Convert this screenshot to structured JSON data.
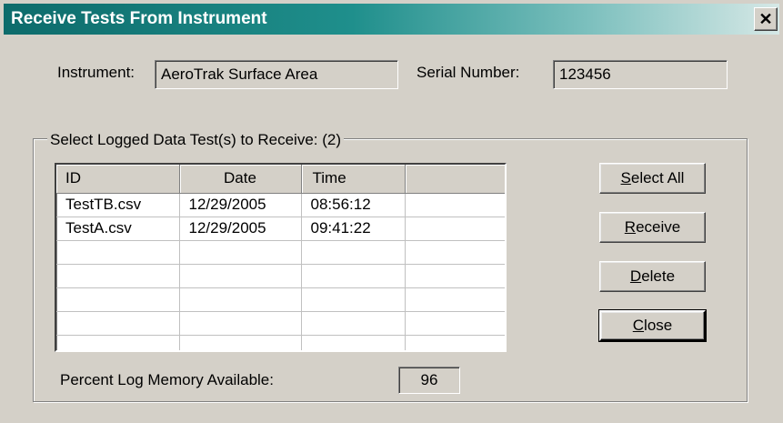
{
  "window": {
    "title": "Receive Tests From Instrument",
    "close_glyph": "✕"
  },
  "instrument": {
    "label": "Instrument:",
    "value": "AeroTrak Surface Area"
  },
  "serial": {
    "label": "Serial Number:",
    "value": "123456"
  },
  "group": {
    "title": "Select Logged Data Test(s) to Receive: (2)"
  },
  "table": {
    "columns": [
      "ID",
      "Date",
      "Time",
      ""
    ],
    "rows": [
      [
        "TestTB.csv",
        "12/29/2005",
        "08:56:12",
        ""
      ],
      [
        "TestA.csv",
        "12/29/2005",
        "09:41:22",
        ""
      ],
      [
        "",
        "",
        "",
        ""
      ],
      [
        "",
        "",
        "",
        ""
      ],
      [
        "",
        "",
        "",
        ""
      ],
      [
        "",
        "",
        "",
        ""
      ],
      [
        "",
        "",
        "",
        ""
      ]
    ]
  },
  "buttons": {
    "select_all": {
      "mnemonic": "S",
      "rest": "elect All"
    },
    "receive": {
      "mnemonic": "R",
      "rest": "eceive"
    },
    "delete": {
      "mnemonic": "D",
      "rest": "elete"
    },
    "close": {
      "mnemonic": "C",
      "rest": "lose"
    }
  },
  "memory": {
    "label": "Percent Log Memory Available:",
    "value": "96"
  }
}
